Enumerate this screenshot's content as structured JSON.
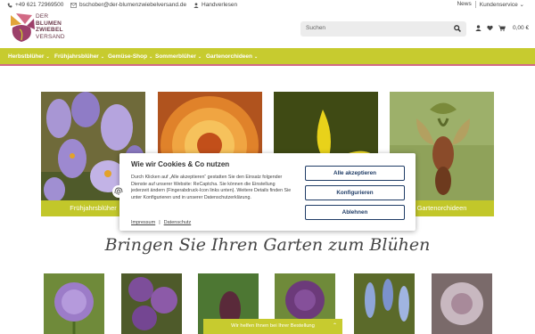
{
  "topbar": {
    "phone": "+49 621 72969500",
    "email": "bschober@der-blumenzwiebelversand.de",
    "handpicked": "Handverlesen",
    "news": "News",
    "service": "Kundenservice",
    "service_chevron": "⌄"
  },
  "logo": {
    "line1": "DER",
    "line2": "BLUMEN",
    "line3": "ZWIEBEL",
    "line4": "VERSAND",
    "colors": [
      "#e2a43a",
      "#d26a85",
      "#9c3f6a",
      "#c7cb2f"
    ]
  },
  "search": {
    "placeholder": "Suchen"
  },
  "header": {
    "cart_total": "0,00 €"
  },
  "nav": {
    "items": [
      {
        "label": "Herbstblüher"
      },
      {
        "label": "Frühjahrsblüher"
      },
      {
        "label": "Gemüse-Shop"
      },
      {
        "label": "Sommerblüher"
      },
      {
        "label": "Gartenorchideen"
      }
    ],
    "chevron": "⌄",
    "accent": "#c7cb2f",
    "underline": "#d26a85"
  },
  "tiles": [
    {
      "caption": "Frühjahrsblüher"
    },
    {
      "caption": ""
    },
    {
      "caption": ""
    },
    {
      "caption": "Gartenorchideen"
    }
  ],
  "headline": "Bringen Sie Ihren Garten zum Blühen",
  "cookie": {
    "title": "Wie wir Cookies & Co nutzen",
    "text": "Durch Klicken auf „Alle akzeptieren“ gestatten Sie den Einsatz folgender Dienste auf unserer Website: ReCaptcha. Sie können die Einstellung jederzeit ändern (Fingerabdruck-Icon links unten). Weitere Details finden Sie unter Konfigurieren und in unserer Datenschutzerklärung.",
    "link_imprint": "Impressum",
    "link_sep": "|",
    "link_privacy": "Datenschutz",
    "accept_all": "Alle akzeptieren",
    "configure": "Konfigurieren",
    "reject": "Ablehnen"
  },
  "banner": {
    "text": "Wir helfen Ihnen bei Ihrer Bestellung",
    "chevron": "⌃"
  }
}
